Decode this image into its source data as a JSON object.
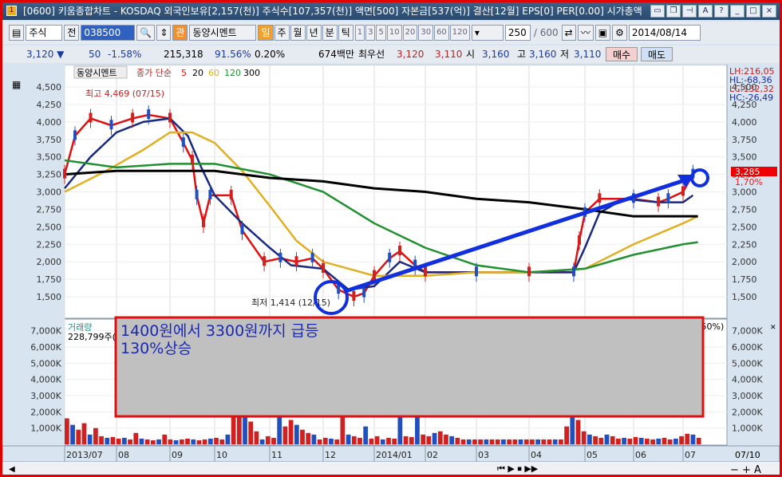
{
  "window": {
    "title": "[0600] 키움종합차트 - KOSDAQ 외국인보유[2,157(천)] 주식수[107,357(천)] 액면[500] 자본금[537(억)] 결산[12월] EPS[0] PER[0.00] 시가총액",
    "icon": "1",
    "buttons": [
      "▭",
      "❐",
      "⊣",
      "A",
      "?",
      "_",
      "□",
      "×"
    ]
  },
  "toolbar": {
    "market": "주식",
    "prev": "전",
    "code": "038500",
    "fav": "관",
    "name": "동양시멘트",
    "periods": [
      "일",
      "주",
      "월",
      "년",
      "분",
      "틱"
    ],
    "active_period": "일",
    "intervals": [
      "1",
      "3",
      "5",
      "10",
      "20",
      "30",
      "60",
      "120"
    ],
    "count": "250",
    "max": "/ 600",
    "date": "2014/08/14"
  },
  "info": {
    "price": "3,120 ▼",
    "change": "50",
    "change_pct": "-1.58%",
    "volume": "215,318",
    "vol_ratio": "91.56%",
    "turnover": "0.20%",
    "amount": "674백만",
    "best_label": "최우선",
    "ask": "3,120",
    "bid": "3,110",
    "open_label": "시",
    "open": "3,160",
    "high_label": "고",
    "high": "3,160",
    "low_label": "저",
    "low": "3,110",
    "buy": "매수",
    "sell": "매도"
  },
  "legend": {
    "name": "동양시멘트",
    "ma_label": "종가 단순",
    "ma": [
      "5",
      "20",
      "60",
      "120",
      "300"
    ]
  },
  "stats": {
    "lh": "LH:216,05",
    "hl": "HL:-68,36",
    "lc": "LC:132,32",
    "hc": "HC:-26,49"
  },
  "current": {
    "price": "3,285",
    "pct": "1,70%"
  },
  "annotations": {
    "high": "최고 4,469 (07/15)",
    "low": "최저 1,414 (12/15)",
    "note1": "1400원에서 3300원까지 급등",
    "note2": "130%상승"
  },
  "volume_legend": {
    "label": "거래량",
    "value": "228,799주(",
    "pct": ".50%)"
  },
  "bottom": {
    "last_date": "07/10"
  },
  "colors": {
    "ma5": "#e01010",
    "ma20": "#1a2a80",
    "ma60": "#e0b020",
    "ma120": "#209030",
    "ma300": "#000000",
    "arrow": "#1030e0",
    "up": "#d02020",
    "down": "#2050c0"
  },
  "chart_data": {
    "type": "line",
    "title": "동양시멘트 일봉",
    "x_unit": "months since 2013/07",
    "x_ticks": [
      "2013/07",
      "08",
      "09",
      "10",
      "11",
      "12",
      "2014/01",
      "02",
      "03",
      "04",
      "05",
      "06",
      "07"
    ],
    "y_ticks": [
      "4,500",
      "4,250",
      "4,000",
      "3,750",
      "3,500",
      "3,250",
      "3,000",
      "2,750",
      "2,500",
      "2,250",
      "2,000",
      "1,750",
      "1,500"
    ],
    "ylim": [
      1250,
      4750
    ],
    "series": [
      {
        "name": "5",
        "points": [
          [
            0,
            3250
          ],
          [
            0.2,
            3800
          ],
          [
            0.5,
            4050
          ],
          [
            0.9,
            3950
          ],
          [
            1.3,
            4050
          ],
          [
            1.6,
            4100
          ],
          [
            2.0,
            4050
          ],
          [
            2.3,
            3700
          ],
          [
            2.5,
            3450
          ],
          [
            2.6,
            2950
          ],
          [
            2.75,
            2550
          ],
          [
            2.9,
            2950
          ],
          [
            3.3,
            2950
          ],
          [
            3.5,
            2450
          ],
          [
            3.9,
            2000
          ],
          [
            4.2,
            2050
          ],
          [
            4.5,
            2000
          ],
          [
            4.8,
            2050
          ],
          [
            5.0,
            1900
          ],
          [
            5.3,
            1600
          ],
          [
            5.6,
            1500
          ],
          [
            5.8,
            1550
          ],
          [
            6.0,
            1800
          ],
          [
            6.3,
            2050
          ],
          [
            6.5,
            2150
          ],
          [
            6.8,
            1950
          ],
          [
            7.0,
            1850
          ],
          [
            8,
            1850
          ],
          [
            9,
            1850
          ],
          [
            9.8,
            1850
          ],
          [
            9.9,
            2300
          ],
          [
            10,
            2700
          ],
          [
            10.3,
            2900
          ],
          [
            11,
            2900
          ],
          [
            11.5,
            2850
          ],
          [
            11.7,
            2900
          ],
          [
            12.0,
            3000
          ],
          [
            12.2,
            3250
          ]
        ]
      },
      {
        "name": "20",
        "points": [
          [
            0,
            3050
          ],
          [
            0.5,
            3500
          ],
          [
            1,
            3850
          ],
          [
            1.5,
            4000
          ],
          [
            2,
            4050
          ],
          [
            2.4,
            3800
          ],
          [
            2.7,
            3350
          ],
          [
            3.0,
            2950
          ],
          [
            3.5,
            2550
          ],
          [
            4,
            2200
          ],
          [
            4.4,
            1950
          ],
          [
            5,
            1900
          ],
          [
            5.5,
            1600
          ],
          [
            6,
            1650
          ],
          [
            6.5,
            2000
          ],
          [
            7,
            1850
          ],
          [
            8,
            1850
          ],
          [
            9,
            1850
          ],
          [
            9.8,
            1850
          ],
          [
            10,
            2200
          ],
          [
            10.3,
            2700
          ],
          [
            10.8,
            2900
          ],
          [
            11.5,
            2850
          ],
          [
            12,
            2850
          ],
          [
            12.2,
            2950
          ]
        ]
      },
      {
        "name": "60",
        "points": [
          [
            0,
            3000
          ],
          [
            0.8,
            3300
          ],
          [
            1.5,
            3600
          ],
          [
            2.0,
            3850
          ],
          [
            2.5,
            3850
          ],
          [
            3,
            3700
          ],
          [
            3.5,
            3300
          ],
          [
            4,
            2800
          ],
          [
            4.5,
            2300
          ],
          [
            5,
            2000
          ],
          [
            5.5,
            1900
          ],
          [
            6,
            1800
          ],
          [
            7,
            1800
          ],
          [
            8,
            1850
          ],
          [
            9,
            1850
          ],
          [
            10,
            1900
          ],
          [
            11,
            2250
          ],
          [
            12,
            2550
          ],
          [
            12.3,
            2650
          ]
        ]
      },
      {
        "name": "120",
        "points": [
          [
            0,
            3450
          ],
          [
            1,
            3350
          ],
          [
            2,
            3400
          ],
          [
            3,
            3400
          ],
          [
            4,
            3250
          ],
          [
            5,
            3000
          ],
          [
            6,
            2550
          ],
          [
            7,
            2200
          ],
          [
            8,
            1950
          ],
          [
            9,
            1850
          ],
          [
            10,
            1900
          ],
          [
            11,
            2100
          ],
          [
            12,
            2250
          ],
          [
            12.3,
            2280
          ]
        ]
      },
      {
        "name": "300",
        "points": [
          [
            0,
            3250
          ],
          [
            1,
            3300
          ],
          [
            2,
            3300
          ],
          [
            3,
            3300
          ],
          [
            4,
            3200
          ],
          [
            5,
            3150
          ],
          [
            6,
            3050
          ],
          [
            7,
            3000
          ],
          [
            8,
            2900
          ],
          [
            9,
            2850
          ],
          [
            10,
            2750
          ],
          [
            11,
            2650
          ],
          [
            12,
            2650
          ],
          [
            12.3,
            2650
          ]
        ]
      }
    ],
    "volume": {
      "y_ticks": [
        "7,000K",
        "6,000K",
        "5,000K",
        "4,000K",
        "3,000K",
        "2,000K",
        "1,000K"
      ],
      "ylim": [
        0,
        7500
      ],
      "values_k": [
        1600,
        1200,
        900,
        1300,
        600,
        1000,
        500,
        400,
        450,
        350,
        400,
        300,
        700,
        350,
        300,
        250,
        300,
        600,
        300,
        250,
        300,
        350,
        300,
        250,
        300,
        350,
        400,
        300,
        600,
        5500,
        5200,
        3000,
        1400,
        800,
        300,
        500,
        400,
        6000,
        1100,
        1500,
        1200,
        900,
        700,
        600,
        300,
        400,
        350,
        300,
        2800,
        600,
        500,
        400,
        1100,
        350,
        500,
        300,
        400,
        350,
        1700,
        500,
        450,
        2200,
        600,
        500,
        700,
        800,
        600,
        500,
        400,
        300,
        300,
        300,
        300,
        300,
        300,
        300,
        300,
        300,
        300,
        300,
        300,
        300,
        300,
        300,
        300,
        300,
        300,
        1100,
        7000,
        1500,
        800,
        600,
        500,
        400,
        600,
        500,
        350,
        400,
        350,
        450,
        400,
        350,
        300,
        350,
        400,
        300,
        350,
        500,
        650,
        600,
        400
      ]
    }
  }
}
